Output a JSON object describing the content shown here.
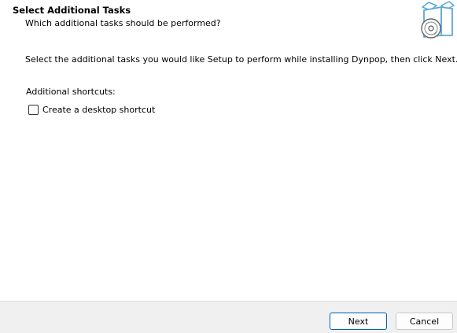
{
  "header": {
    "title": "Select Additional Tasks",
    "subtitle": "Which additional tasks should be performed?",
    "icon": "setup-box-disc-icon"
  },
  "main": {
    "instructions": "Select the additional tasks you would like Setup to perform while installing Dynpop, then click Next.",
    "group_label": "Additional shortcuts:",
    "tasks": [
      {
        "label": "Create a desktop shortcut",
        "checked": false
      }
    ]
  },
  "footer": {
    "next_label": "Next",
    "cancel_label": "Cancel"
  },
  "colors": {
    "accent": "#005fb8",
    "footer_bg": "#f0f0f0",
    "icon_blue": "#5aa9d8"
  }
}
